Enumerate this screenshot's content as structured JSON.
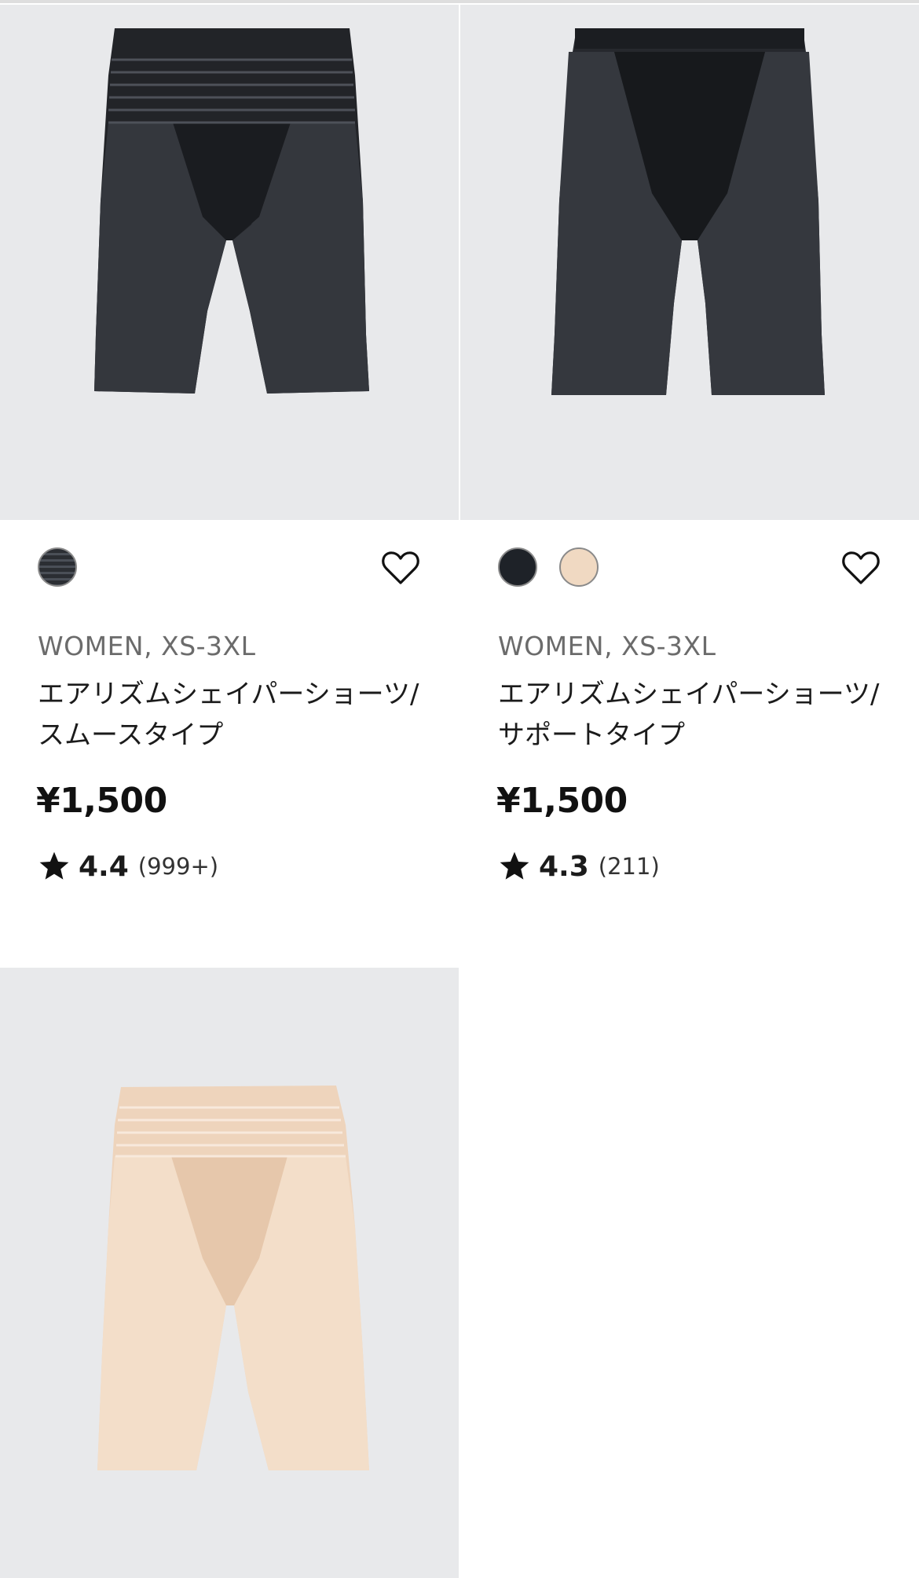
{
  "products": [
    {
      "image_alt": "black shaper shorts smooth type",
      "swatches": [
        {
          "name": "striped-black",
          "color": "#2b2e33"
        }
      ],
      "category": "WOMEN, XS-3XL",
      "name": "エアリズムシェイパーショーツ/スムースタイプ",
      "price": "¥1,500",
      "rating": "4.4",
      "review_count": "(999+)"
    },
    {
      "image_alt": "black shaper shorts support type",
      "swatches": [
        {
          "name": "black",
          "color": "#1e2228"
        },
        {
          "name": "beige",
          "color": "#f0d9c2"
        }
      ],
      "category": "WOMEN, XS-3XL",
      "name": "エアリズムシェイパーショーツ/サポートタイプ",
      "price": "¥1,500",
      "rating": "4.3",
      "review_count": "(211)"
    },
    {
      "image_alt": "beige shaper shorts",
      "color": "#f1d7bf"
    }
  ],
  "colors": {
    "image_background": "#e8e9eb",
    "text_primary": "#1b1b1b",
    "text_secondary": "#6b6b6b",
    "garment_black": "#1e2228",
    "garment_beige": "#f1d7bf"
  },
  "icons": {
    "favorite": "heart-outline-icon",
    "rating": "star-filled-icon"
  }
}
